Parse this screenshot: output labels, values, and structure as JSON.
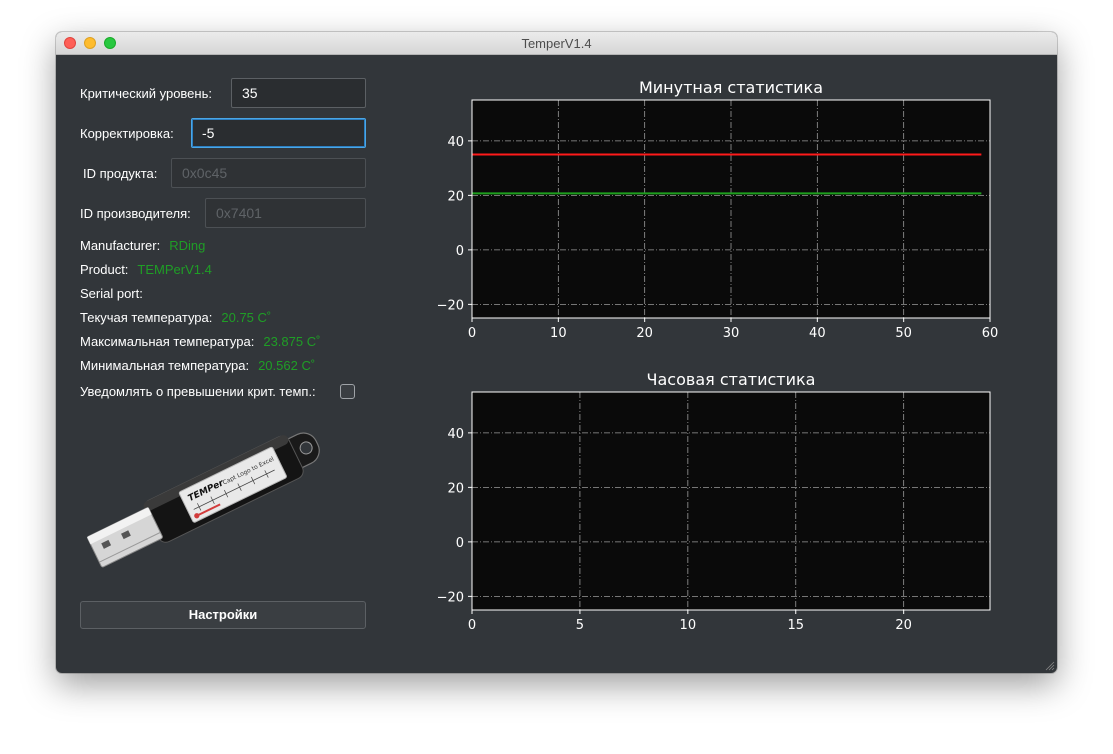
{
  "window": {
    "title": "TemperV1.4"
  },
  "form": {
    "critical_label": "Критический уровень:",
    "critical_value": "35",
    "correction_label": "Корректировка:",
    "correction_value": "-5",
    "product_id_label": "ID продукта:",
    "product_id_placeholder": "0x0c45",
    "vendor_id_label": "ID производителя:",
    "vendor_id_placeholder": "0x7401"
  },
  "info": {
    "manufacturer_label": "Manufacturer:",
    "manufacturer_value": "RDing",
    "product_label": "Product:",
    "product_value": "TEMPerV1.4",
    "serial_label": "Serial port:",
    "serial_value": "",
    "current_temp_label": "Текучая температура:",
    "current_temp_value": "20.75 C˚",
    "max_temp_label": "Максимальная температура:",
    "max_temp_value": "23.875 C˚",
    "min_temp_label": "Минимальная температура:",
    "min_temp_value": "20.562 C˚",
    "notify_label": "Уведомлять о превышении крит. темп.:",
    "notify_checked": false
  },
  "device_image": {
    "label_text": "TEMPer",
    "sub_text": "Capt Logo to Excel"
  },
  "settings_button": "Настройки",
  "colors": {
    "critical_line": "#ff1a1a",
    "temperature_line": "#1ea01e",
    "plot_bg": "#0a0a0a"
  },
  "chart_data": [
    {
      "type": "line",
      "title": "Минутная статистика",
      "xlim": [
        0,
        60
      ],
      "ylim": [
        -25,
        55
      ],
      "xticks": [
        0,
        10,
        20,
        30,
        40,
        50,
        60
      ],
      "yticks": [
        -20,
        0,
        20,
        40
      ],
      "grid": true,
      "series": [
        {
          "color": "#ff1a1a",
          "x": [
            0,
            59
          ],
          "y": [
            35,
            35
          ]
        },
        {
          "color": "#1ea01e",
          "x": [
            0,
            59
          ],
          "y": [
            20.75,
            20.75
          ]
        }
      ]
    },
    {
      "type": "line",
      "title": "Часовая статистика",
      "xlim": [
        0,
        24
      ],
      "ylim": [
        -25,
        55
      ],
      "xticks": [
        0,
        5,
        10,
        15,
        20
      ],
      "yticks": [
        -20,
        0,
        20,
        40
      ],
      "grid": true,
      "series": []
    }
  ]
}
